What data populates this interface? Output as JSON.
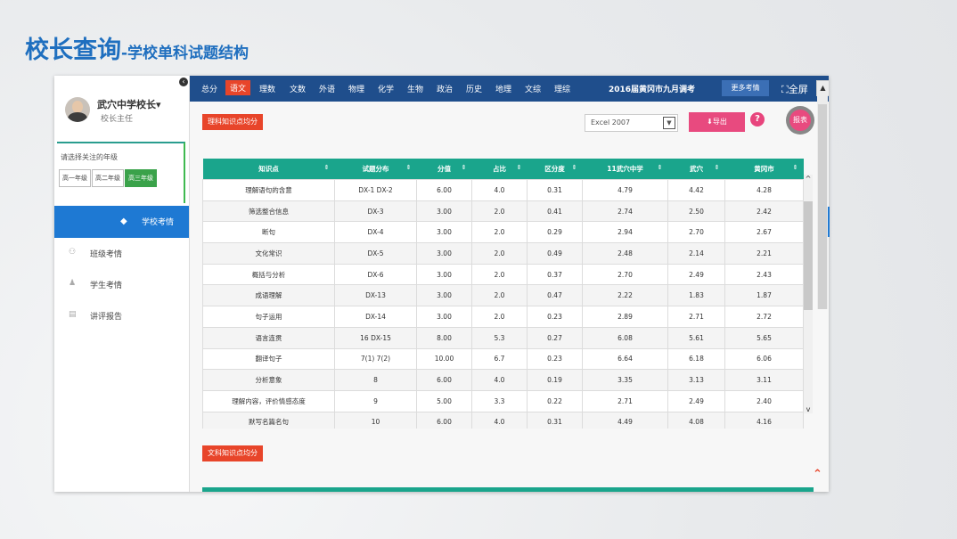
{
  "page_title": {
    "main": "校长查询",
    "sub": "-学校单科试题结构"
  },
  "sidebar": {
    "user_name": "武穴中学校长",
    "user_role": "校长主任",
    "grade_prompt": "请选择关注的年级",
    "grades": [
      "高一年级",
      "高二年级",
      "高三年级"
    ],
    "active_grade": "高三年级",
    "active_nav": "学校考情",
    "nav_items": [
      {
        "label": "班级考情",
        "icon": "users-icon"
      },
      {
        "label": "学生考情",
        "icon": "user-icon"
      },
      {
        "label": "讲评报告",
        "icon": "report-icon"
      }
    ]
  },
  "topnav": {
    "subjects": [
      "总分",
      "语文",
      "理数",
      "文数",
      "外语",
      "物理",
      "化学",
      "生物",
      "政治",
      "历史",
      "地理",
      "文综",
      "理综"
    ],
    "active_subject": "语文",
    "exam_title": "2016届黄冈市九月调考",
    "more_label": "更多考情",
    "fullscreen_label": "全屏"
  },
  "toolbar": {
    "section_label": "理科知识点均分",
    "format_value": "Excel 2007",
    "export_label": "导出",
    "help_label": "?",
    "report_label": "报表"
  },
  "table": {
    "headers": [
      "知识点",
      "试题分布",
      "分值",
      "占比",
      "区分度",
      "11武穴中学",
      "武穴",
      "黄冈市"
    ],
    "rows": [
      [
        "理解语句的含意",
        "DX-1 DX-2",
        "6.00",
        "4.0",
        "0.31",
        "4.79",
        "4.42",
        "4.28"
      ],
      [
        "筛选整合信息",
        "DX-3",
        "3.00",
        "2.0",
        "0.41",
        "2.74",
        "2.50",
        "2.42"
      ],
      [
        "断句",
        "DX-4",
        "3.00",
        "2.0",
        "0.29",
        "2.94",
        "2.70",
        "2.67"
      ],
      [
        "文化常识",
        "DX-5",
        "3.00",
        "2.0",
        "0.49",
        "2.48",
        "2.14",
        "2.21"
      ],
      [
        "概括与分析",
        "DX-6",
        "3.00",
        "2.0",
        "0.37",
        "2.70",
        "2.49",
        "2.43"
      ],
      [
        "成语理解",
        "DX-13",
        "3.00",
        "2.0",
        "0.47",
        "2.22",
        "1.83",
        "1.87"
      ],
      [
        "句子运用",
        "DX-14",
        "3.00",
        "2.0",
        "0.23",
        "2.89",
        "2.71",
        "2.72"
      ],
      [
        "语言连贯",
        "16 DX-15",
        "8.00",
        "5.3",
        "0.27",
        "6.08",
        "5.61",
        "5.65"
      ],
      [
        "翻译句子",
        "7(1) 7(2)",
        "10.00",
        "6.7",
        "0.23",
        "6.64",
        "6.18",
        "6.06"
      ],
      [
        "分析意象",
        "8",
        "6.00",
        "4.0",
        "0.19",
        "3.35",
        "3.13",
        "3.11"
      ],
      [
        "理解内容，评价情感态度",
        "9",
        "5.00",
        "3.3",
        "0.22",
        "2.71",
        "2.49",
        "2.40"
      ],
      [
        "默写名篇名句",
        "10",
        "6.00",
        "4.0",
        "0.31",
        "4.49",
        "4.08",
        "4.16"
      ]
    ]
  },
  "section2_label": "文科知识点均分"
}
